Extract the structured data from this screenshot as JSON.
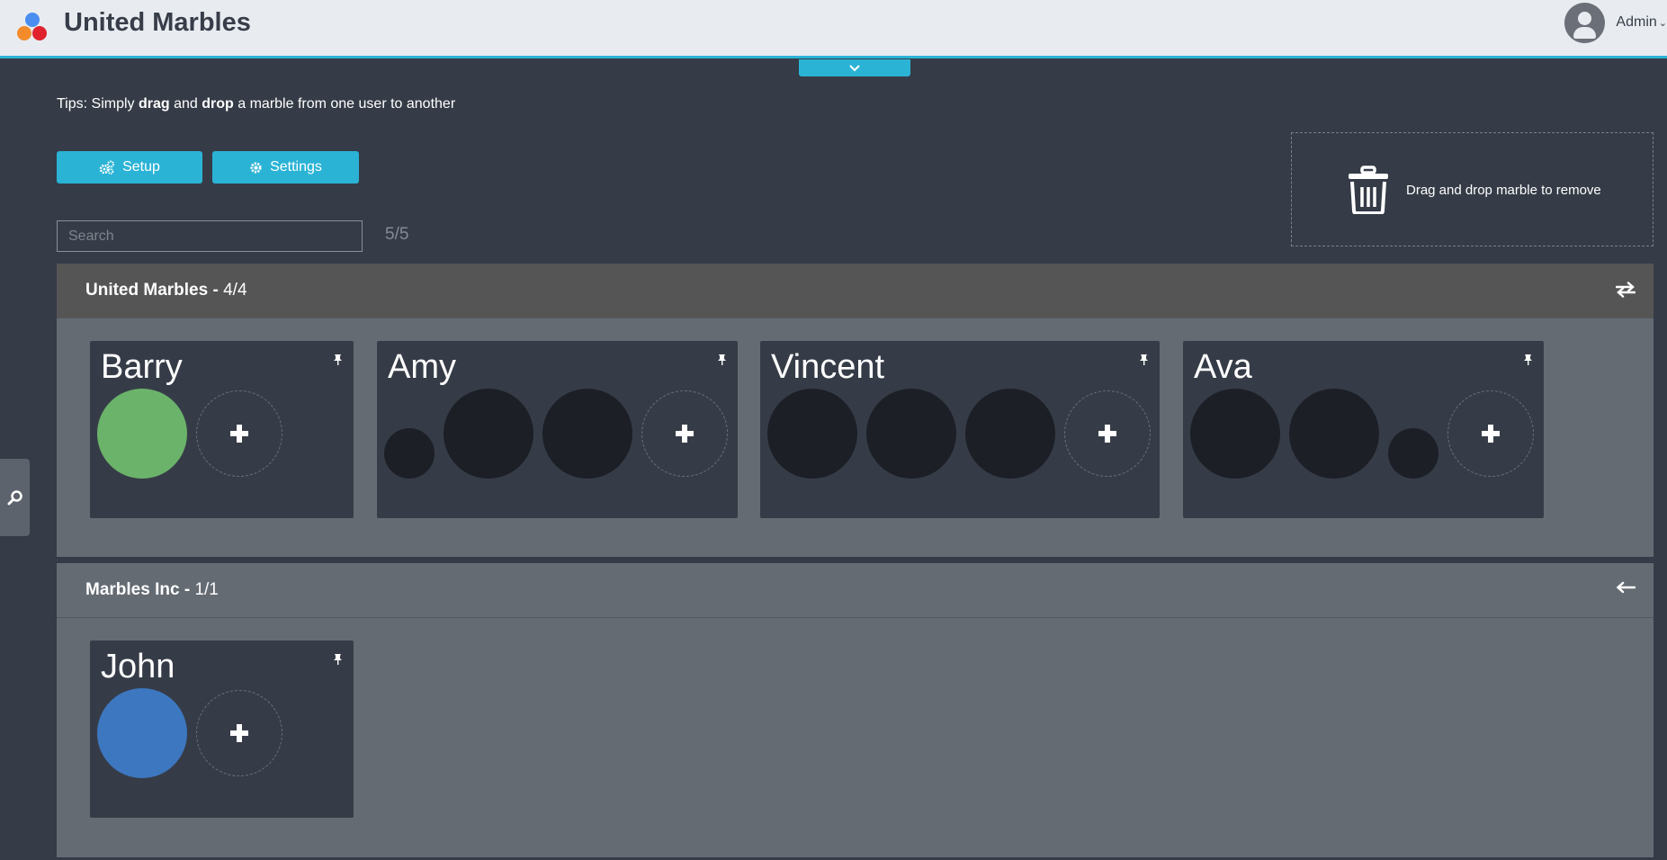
{
  "app": {
    "title": "United Marbles",
    "logo_colors": [
      "#4a8ef0",
      "#f38b2a",
      "#e0212e"
    ]
  },
  "user": {
    "name": "Admin",
    "icon": "user-avatar-icon"
  },
  "tips": {
    "prefix": "Tips: Simply ",
    "drag": "drag",
    "middle": " and ",
    "drop": "drop",
    "suffix": " a marble from one user to another"
  },
  "buttons": {
    "setup": "Setup",
    "settings": "Settings"
  },
  "search": {
    "placeholder": "Search",
    "value": "",
    "count": "5/5"
  },
  "trash": {
    "text": "Drag and drop marble to remove",
    "icon": "trash-icon"
  },
  "colors": {
    "accent": "#2bb3d6",
    "background": "#353c47",
    "card": "#363c47",
    "group_panel": "#646b73",
    "group_header_active": "#555555",
    "marble_dark": "#1c1f26",
    "marble_green": "#6bb36a",
    "marble_blue": "#3c77c0"
  },
  "groups": [
    {
      "name": "United Marbles",
      "sep": " - ",
      "count": "4/4",
      "toggle_icon": "swap-arrows-icon",
      "users": [
        {
          "name": "Barry",
          "marbles": [
            {
              "color": "#6bb36a",
              "size": "large"
            }
          ]
        },
        {
          "name": "Amy",
          "marbles": [
            {
              "color": "#1c1f26",
              "size": "small"
            },
            {
              "color": "#1c1f26",
              "size": "large"
            },
            {
              "color": "#1c1f26",
              "size": "large"
            }
          ]
        },
        {
          "name": "Vincent",
          "marbles": [
            {
              "color": "#1c1f26",
              "size": "large"
            },
            {
              "color": "#1c1f26",
              "size": "large"
            },
            {
              "color": "#1c1f26",
              "size": "large"
            }
          ]
        },
        {
          "name": "Ava",
          "marbles": [
            {
              "color": "#1c1f26",
              "size": "large"
            },
            {
              "color": "#1c1f26",
              "size": "large"
            },
            {
              "color": "#1c1f26",
              "size": "small"
            }
          ]
        }
      ]
    },
    {
      "name": "Marbles Inc",
      "sep": " - ",
      "count": "1/1",
      "toggle_icon": "arrow-left-icon",
      "users": [
        {
          "name": "John",
          "marbles": [
            {
              "color": "#3c77c0",
              "size": "large"
            }
          ]
        }
      ]
    }
  ]
}
